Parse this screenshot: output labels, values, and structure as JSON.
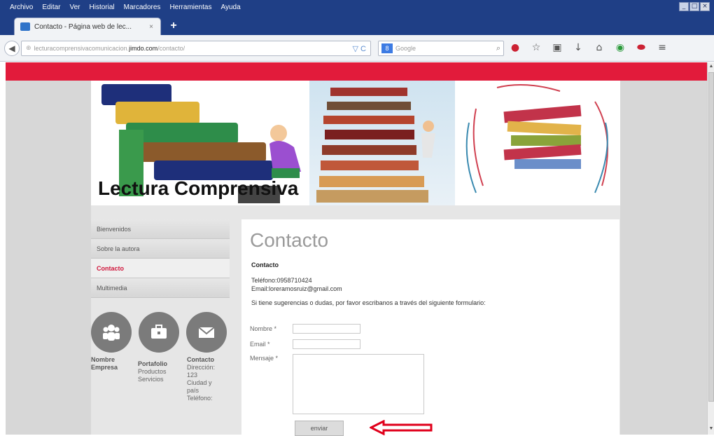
{
  "browser": {
    "menu": [
      "Archivo",
      "Editar",
      "Ver",
      "Historial",
      "Marcadores",
      "Herramientas",
      "Ayuda"
    ],
    "tab_title": "Contacto - Página web de lec...",
    "tab_close": "×",
    "new_tab": "+",
    "url_grey": "lecturacomprensivacomunicacion.",
    "url_domain": "jimdo.com",
    "url_path": "/contacto/",
    "url_controls": "▽ C",
    "search_engine": "8",
    "search_placeholder": "Google",
    "search_icon": "⌕",
    "window_controls": [
      "_",
      "□",
      "×"
    ]
  },
  "site": {
    "title": "Lectura Comprensiva",
    "nav": [
      {
        "label": "Bienvenidos",
        "active": false
      },
      {
        "label": "Sobre la autora",
        "active": false
      },
      {
        "label": "Contacto",
        "active": true
      },
      {
        "label": "Multimedia",
        "active": false
      }
    ],
    "footer": [
      {
        "title": "Nombre Empresa",
        "lines": []
      },
      {
        "title": "Portafolio",
        "lines": [
          "Productos",
          "Servicios"
        ]
      },
      {
        "title": "Contacto",
        "lines": [
          "Dirección:",
          "123",
          "Ciudad y",
          "país",
          "Teléfono:"
        ]
      }
    ]
  },
  "contact": {
    "heading": "Contacto",
    "subheading": "Contacto",
    "phone": "Teléfono:0958710424",
    "email": "Email:loreramosruiz@gmail.com",
    "message": "Si tiene sugerencias o dudas, por favor escribanos a través del siguiente formulario:",
    "form": {
      "name_label": "Nombre *",
      "email_label": "Email *",
      "message_label": "Mensaje *",
      "submit_label": "enviar"
    }
  },
  "colors": {
    "accent": "#e21b3b",
    "annotation_arrow": "#e0001b"
  }
}
